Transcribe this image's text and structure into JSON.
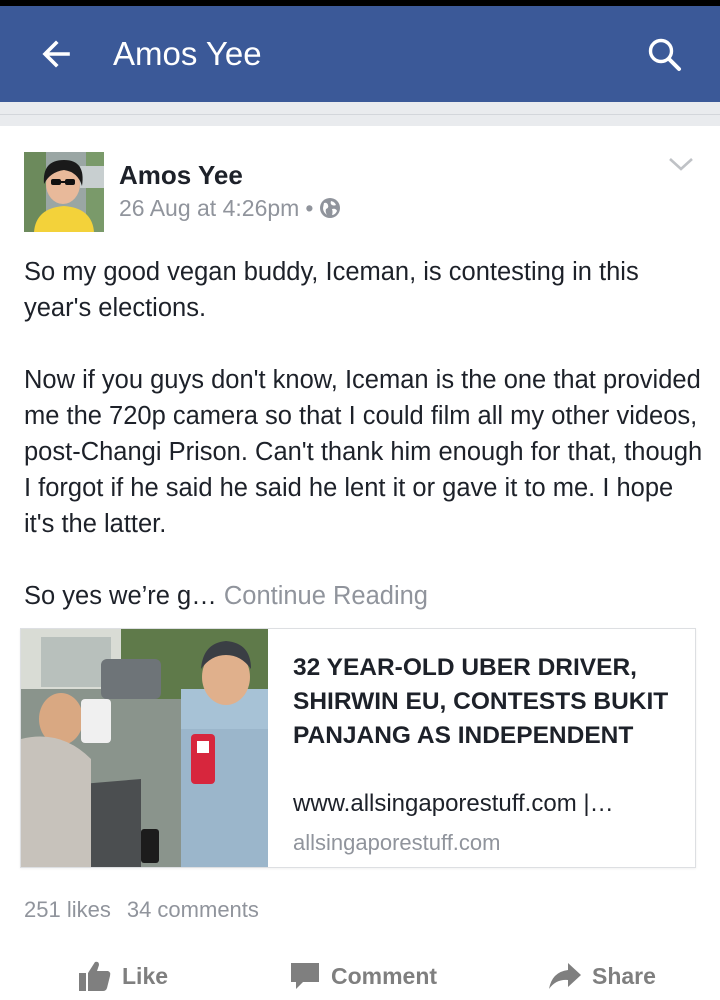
{
  "app_bar": {
    "title": "Amos Yee",
    "back_icon": "arrow-left-icon",
    "search_icon": "search-icon",
    "color": "#3b5998"
  },
  "post": {
    "author": "Amos Yee",
    "timestamp": "26 Aug at 4:26pm",
    "separator": "•",
    "privacy_icon": "globe-icon",
    "menu_icon": "chevron-down-icon",
    "paragraphs": [
      "So my good vegan buddy, Iceman, is contesting in this year's elections.",
      "Now if you guys don't know, Iceman is the one that provided me the 720p camera so that I could film all my other videos, post-Changi Prison. Can't thank him enough for that, though I forgot if he said he said he lent it or gave it to me. I hope it's the latter."
    ],
    "truncated_text": "So yes we’re g…",
    "continue_label": "Continue Reading"
  },
  "link_preview": {
    "title": "32 YEAR-OLD UBER DRIVER, SHIRWIN EU, CONTESTS BUKIT PANJANG AS INDEPENDENT",
    "url": "www.allsingaporestuff.com |…",
    "domain": "allsingaporestuff.com"
  },
  "stats": {
    "likes": "251 likes",
    "comments": "34 comments"
  },
  "actions": {
    "like": "Like",
    "comment": "Comment",
    "share": "Share",
    "like_icon": "thumbs-up-icon",
    "comment_icon": "comment-icon",
    "share_icon": "share-arrow-icon"
  }
}
